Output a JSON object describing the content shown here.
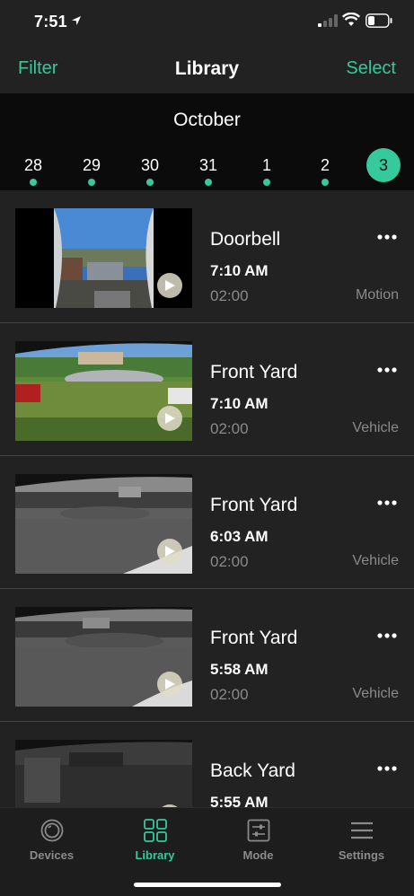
{
  "status_bar": {
    "time": "7:51"
  },
  "header": {
    "left": "Filter",
    "title": "Library",
    "right": "Select"
  },
  "calendar": {
    "month": "October",
    "days": [
      "28",
      "29",
      "30",
      "31",
      "1",
      "2",
      "3"
    ],
    "selected": "3"
  },
  "clips": [
    {
      "name": "Doorbell",
      "time": "7:10 AM",
      "duration": "02:00",
      "type": "Motion"
    },
    {
      "name": "Front Yard",
      "time": "7:10 AM",
      "duration": "02:00",
      "type": "Vehicle"
    },
    {
      "name": "Front Yard",
      "time": "6:03 AM",
      "duration": "02:00",
      "type": "Vehicle"
    },
    {
      "name": "Front Yard",
      "time": "5:58 AM",
      "duration": "02:00",
      "type": "Vehicle"
    },
    {
      "name": "Back Yard",
      "time": "5:55 AM",
      "duration": "",
      "type": ""
    }
  ],
  "tabs": [
    {
      "label": "Devices",
      "icon": "devices-icon"
    },
    {
      "label": "Library",
      "icon": "library-grid-icon"
    },
    {
      "label": "Mode",
      "icon": "mode-sliders-icon"
    },
    {
      "label": "Settings",
      "icon": "settings-menu-icon"
    }
  ],
  "colors": {
    "accent": "#35c99b",
    "background": "#222222",
    "strip": "#0b0b0b"
  }
}
